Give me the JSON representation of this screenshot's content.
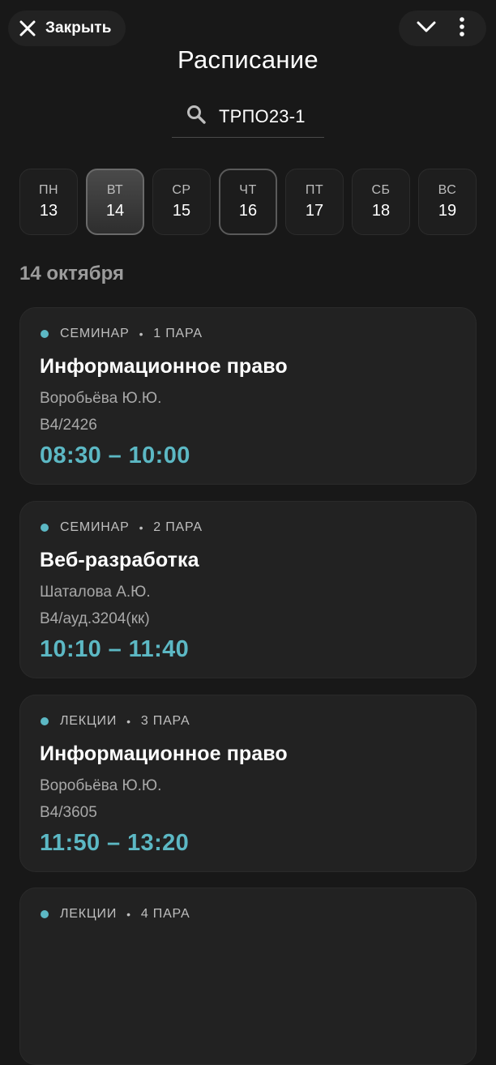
{
  "header": {
    "close_label": "Закрыть",
    "title": "Расписание"
  },
  "search": {
    "value": "ТРПО23-1"
  },
  "week": [
    {
      "name": "ПН",
      "num": "13",
      "state": "normal"
    },
    {
      "name": "ВТ",
      "num": "14",
      "state": "active"
    },
    {
      "name": "СР",
      "num": "15",
      "state": "normal"
    },
    {
      "name": "ЧТ",
      "num": "16",
      "state": "today"
    },
    {
      "name": "ПТ",
      "num": "17",
      "state": "normal"
    },
    {
      "name": "СБ",
      "num": "18",
      "state": "normal"
    },
    {
      "name": "ВС",
      "num": "19",
      "state": "normal"
    }
  ],
  "date_heading": "14 октября",
  "lessons": [
    {
      "type": "СЕМИНАР",
      "pair": "1 ПАРА",
      "subject": "Информационное право",
      "teacher": "Воробьёва Ю.Ю.",
      "room": "В4/2426",
      "time": "08:30 – 10:00"
    },
    {
      "type": "СЕМИНАР",
      "pair": "2 ПАРА",
      "subject": "Веб-разработка",
      "teacher": "Шаталова А.Ю.",
      "room": "В4/ауд.3204(кк)",
      "time": "10:10 – 11:40"
    },
    {
      "type": "ЛЕКЦИИ",
      "pair": "3 ПАРА",
      "subject": "Информационное право",
      "teacher": "Воробьёва Ю.Ю.",
      "room": "В4/3605",
      "time": "11:50 – 13:20"
    },
    {
      "type": "ЛЕКЦИИ",
      "pair": "4 ПАРА",
      "subject": "",
      "teacher": "",
      "room": "",
      "time": ""
    }
  ],
  "colors": {
    "accent": "#5cb8c4",
    "background": "#181818",
    "card": "#222222"
  },
  "icons": {
    "close": "close-icon",
    "collapse": "chevron-down-icon",
    "menu": "more-vertical-icon",
    "search": "search-icon"
  }
}
